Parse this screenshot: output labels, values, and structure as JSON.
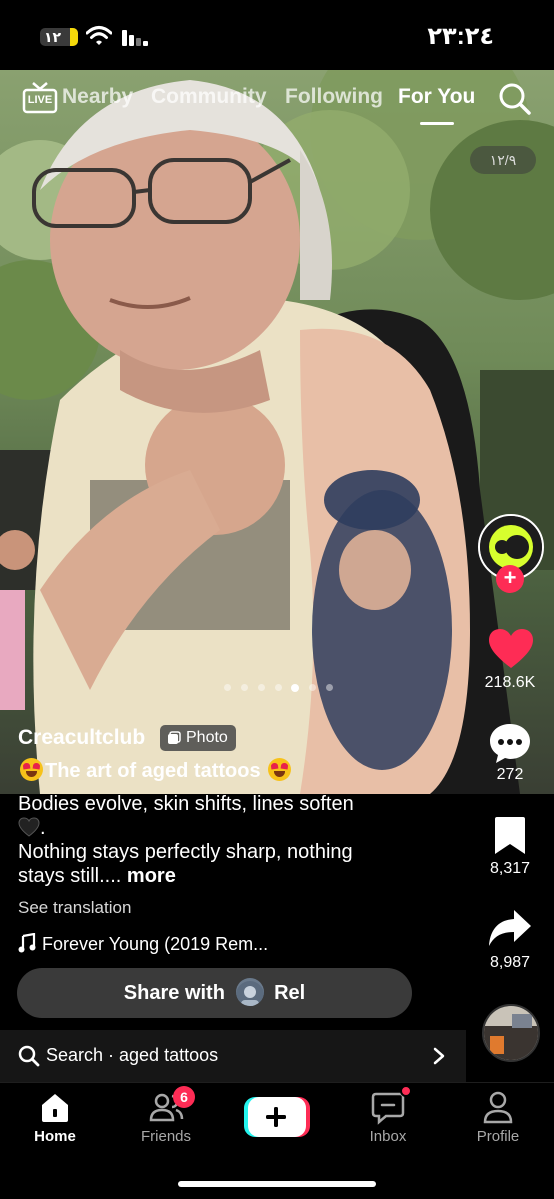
{
  "status_bar": {
    "battery_level": "١٢",
    "clock": "٢٣:٢٤"
  },
  "top_nav": {
    "live_label": "LIVE",
    "tabs": [
      {
        "label": "Nearby"
      },
      {
        "label": "Community"
      },
      {
        "label": "Following"
      },
      {
        "label": "For You",
        "active": true
      }
    ]
  },
  "media": {
    "page_counter": "١٢/٩",
    "carousel_dots_total": 7,
    "carousel_dot_active": 5
  },
  "actions": {
    "author_avatar": "C",
    "likes": "218.6K",
    "comments": "272",
    "saves": "8,317",
    "shares": "8,987"
  },
  "post": {
    "username": "Creacultclub",
    "type_badge": "Photo",
    "title": "The art of aged tattoos",
    "desc_line1": "Bodies evolve, skin shifts, lines soften",
    "desc_line2_suffix": ".",
    "desc_line3": "Nothing stays perfectly sharp, nothing",
    "desc_line4": "stays still....",
    "more_label": "more",
    "see_translation": "See translation",
    "sound": "Forever Young (2019 Rem..."
  },
  "share": {
    "prefix": "Share with",
    "recipient": "Rel"
  },
  "search": {
    "label": "Search · aged tattoos"
  },
  "bottom_nav": {
    "items": [
      {
        "label": "Home",
        "active": true
      },
      {
        "label": "Friends",
        "badge": "6"
      },
      {
        "label": ""
      },
      {
        "label": "Inbox"
      },
      {
        "label": "Profile"
      }
    ]
  },
  "colors": {
    "accent": "#fe2c55",
    "battery": "#f5d90a",
    "button_bg": "#3a3a3a"
  }
}
